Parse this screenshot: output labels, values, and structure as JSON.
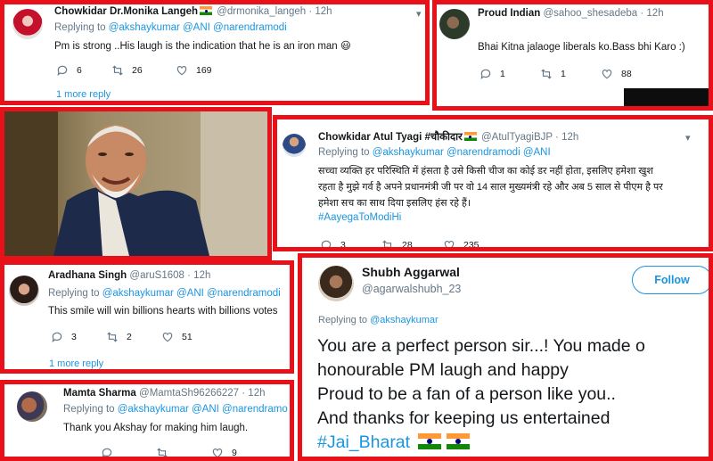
{
  "tweets": {
    "t1": {
      "name": "Chowkidar Dr.Monika Langeh",
      "handle": "@drmonika_langeh",
      "time": "· 12h",
      "replying_prefix": "Replying to ",
      "replying_to": "@akshaykumar @ANI @narendramodi",
      "text": "Pm is strong ..His laugh is the indication that he is an iron man",
      "emoji": "😃",
      "replies": "6",
      "retweets": "26",
      "likes": "169",
      "more_replies": "1 more reply"
    },
    "t2": {
      "name": "Proud Indian",
      "handle": "@sahoo_shesadeba",
      "time": "· 12h",
      "text": "Bhai Kitna jalaoge liberals ko.Bass bhi Karo :)",
      "replies": "1",
      "retweets": "1",
      "likes": "88"
    },
    "t3": {
      "name": "Chowkidar Atul Tyagi #चौकीदार",
      "handle": "@AtulTyagiBJP",
      "time": "· 12h",
      "replying_prefix": "Replying to ",
      "replying_to": "@akshaykumar @narendramodi @ANI",
      "line1": "सच्चा व्यक्ति हर परिस्थिति में हंसता है उसे किसी चीज का कोई डर नहीं होता, इसलिए हमेशा खुश",
      "line2": "रहता है मुझे गर्व है अपने प्रधानमंत्री जी पर वो 14 साल मुख्यमंत्री रहे और अब 5 साल से पीएम है पर",
      "line3": "हमेशा सच का साथ दिया इसलिए हंस रहे हैं।",
      "hashtag": "#AayegaToModiHi",
      "replies": "3",
      "retweets": "28",
      "likes": "235"
    },
    "t4": {
      "name": "Aradhana Singh",
      "handle": "@aruS1608",
      "time": "· 12h",
      "replying_prefix": "Replying to ",
      "replying_to": "@akshaykumar @ANI @narendramodi",
      "text": "This smile will win billions hearts with billions votes",
      "replies": "3",
      "retweets": "2",
      "likes": "51",
      "more_replies": "1 more reply"
    },
    "t5": {
      "name": "Mamta Sharma",
      "handle": "@MamtaSh96266227",
      "time": "· 12h",
      "replying_prefix": "Replying to ",
      "replying_to": "@akshaykumar @ANI @narendramo",
      "text": "Thank you Akshay for making him laugh.",
      "replies": "",
      "retweets": "",
      "likes": "9"
    },
    "t6": {
      "name": "Shubh Aggarwal",
      "handle": "@agarwalshubh_23",
      "follow_label": "Follow",
      "replying_prefix": "Replying to ",
      "replying_to": "@akshaykumar",
      "line1": "You are a perfect person sir...! You made o",
      "line2": "honourable PM laugh and happy",
      "line3": "Proud to be a fan of a person like you..",
      "line4": "And thanks for keeping us entertained",
      "hashtag": "#Jai_Bharat"
    }
  },
  "colors": {
    "border": "#e8111a",
    "link": "#1b95e0",
    "muted": "#657786"
  }
}
